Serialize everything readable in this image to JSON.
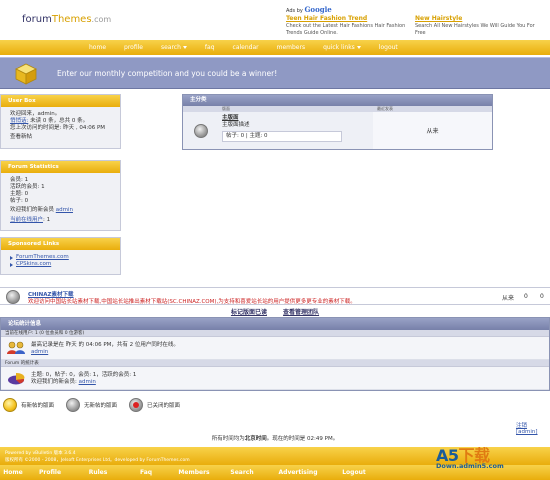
{
  "header": {
    "logo": {
      "part1": "forum",
      "part2": "Themes",
      "part3": ".com"
    },
    "ads_by": "Ads by",
    "ads_brand": "Google",
    "ads": [
      {
        "title": "Teen Hair Fashion Trend",
        "text": "Check out the Latest Hair Fashions Hair Fashion Trends Guide Online."
      },
      {
        "title": "New Hairstyle",
        "text": "Search All New Hairstyles We Will Guide You For Free"
      }
    ]
  },
  "top_nav": [
    {
      "label": "home",
      "dropdown": false
    },
    {
      "label": "profile",
      "dropdown": false
    },
    {
      "label": "search",
      "dropdown": true
    },
    {
      "label": "faq",
      "dropdown": false
    },
    {
      "label": "calendar",
      "dropdown": false
    },
    {
      "label": "members",
      "dropdown": false
    },
    {
      "label": "quick links",
      "dropdown": true
    },
    {
      "label": "logout",
      "dropdown": false
    }
  ],
  "banner": {
    "text": "Enter our monthly competition and you could be a winner!"
  },
  "sidebar": {
    "user_box": {
      "title": "User Box",
      "welcome": "欢迎回来，admin。",
      "pm_link": "悄悄话:",
      "pm_text": " 未读 0 条，总共 0 条。",
      "last_visit": "您上次访问的时间是: 昨天 , 04:06 PM",
      "new_posts": "查看新帖"
    },
    "stats_box": {
      "title": "Forum Statistics",
      "members": "会员: 1",
      "active": "活跃的会员: 1",
      "threads": "主题: 0",
      "posts": "帖子: 0",
      "welcome_prefix": "欢迎我们的新会员 ",
      "newest_member": "admin",
      "online_link": "当前在线用户",
      "online_count": ": 1"
    },
    "sponsored": {
      "title": "Sponsored Links",
      "links": [
        "ForumThemes.com",
        "CPSkins.com"
      ]
    }
  },
  "main_category": {
    "title": "主分类",
    "col_forum": "版面",
    "col_last": "最近发表",
    "forum_name": "主版面",
    "forum_desc": "主版面描述",
    "forum_stats": "帖子: 0 | 主题: 0",
    "last_post": "从来"
  },
  "chinaz": {
    "title": "CHINAZ素材下载",
    "desc": "欢迎访问中国站长站素材下载,中国站长站推出素材下载站(SC.CHINAZ.COM),为支持和喜爱站长站的用户提供更多更专业的素材下载。",
    "last": "从来",
    "threads": "0",
    "posts": "0"
  },
  "mark_links": [
    "标记版面已读",
    "查看管理团队"
  ],
  "forum_stats": {
    "title": "论坛统计信息",
    "online_header": "当前在线用户: 1 (0 位会员和 0 位游客)",
    "record": "最高记录是在 昨天 的 04:06 PM，共有 2 位用户同时在线。",
    "online_user": "admin",
    "stats_header": "Forum 的统计表",
    "stats_line": "主题: 0，帖子: 0，会员: 1，活跃的会员: 1",
    "newest_prefix": "欢迎我们的新会员: ",
    "newest_member": "admin"
  },
  "legend": [
    {
      "label": "有新帖的版面",
      "icon": "yellow-orb-icon"
    },
    {
      "label": "无新帖的版面",
      "icon": "grey-orb-icon"
    },
    {
      "label": "已关闭的版面",
      "icon": "closed-orb-icon"
    }
  ],
  "registered": "注销 [admin]",
  "time_line": {
    "prefix": "所有时间均为",
    "zone": "北京时间",
    "middle": "。现在的时间是 ",
    "time": "02:49 PM",
    "suffix": "。"
  },
  "footer": {
    "line1": "Powered by vBulletin 版本 3.6.4",
    "line2": "版权所有 ©2000 - 2008，Jelsoft Enterprises Ltd。developed by ForumThemes.com"
  },
  "bottom_nav": [
    "Home",
    "Profile",
    "Rules",
    "Faq",
    "Members",
    "Search",
    "Advertising",
    "Logout"
  ],
  "watermark": {
    "big": "A5",
    "big2": "下载",
    "small": "Down.admin5.com"
  },
  "colors": {
    "accent_yellow": "#e9ad0c",
    "banner_blue": "#8f99c4",
    "header_blue": "#7780a9",
    "link_blue": "#3355aa"
  }
}
